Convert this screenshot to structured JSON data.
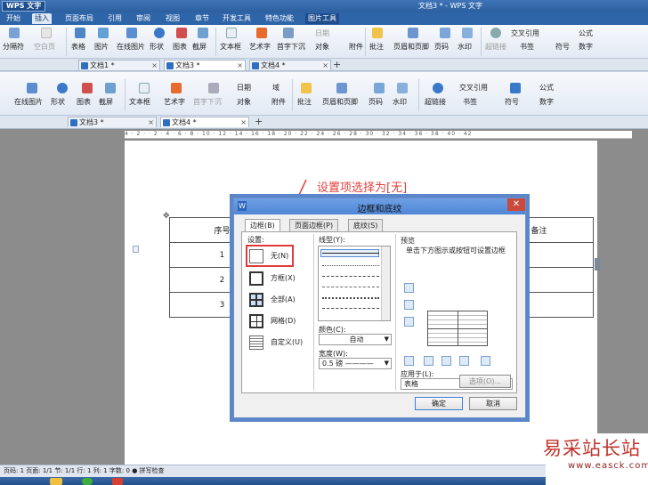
{
  "app": {
    "name": "WPS 文字",
    "window_title": "文档3 * - WPS 文字"
  },
  "menu": [
    "开始",
    "插入",
    "页面布局",
    "引用",
    "审阅",
    "视图",
    "章节",
    "开发工具",
    "特色功能",
    "图片工具"
  ],
  "ribbon1": [
    "分隔符",
    "空白页",
    "表格",
    "图片",
    "在线图片",
    "形状",
    "图表",
    "截屏",
    "文本框",
    "艺术字",
    "首字下沉",
    "日期",
    "对象",
    "附件",
    "批注",
    "页眉和页脚",
    "页码",
    "水印",
    "超链接",
    "交叉引用",
    "书签",
    "符号",
    "公式",
    "数字"
  ],
  "doc_tabs_1": [
    "文档1 *",
    "文档3 *",
    "文档4 *"
  ],
  "ribbon2": [
    "在线图片",
    "形状",
    "图表",
    "截屏",
    "文本框",
    "艺术字",
    "首字下沉",
    "日期",
    "域",
    "对象",
    "附件",
    "批注",
    "页眉和页脚",
    "页码",
    "水印",
    "超链接",
    "交叉引用",
    "书签",
    "符号",
    "公式",
    "数字"
  ],
  "doc_tabs_2": [
    "文档3 *",
    "文档4 *"
  ],
  "ruler": "4 · 2 · · 2 · 4 · 6 · 8 · 10 · 12 · 14 · 16 · 18 · 20 · 22 · 24 · 26 · 28 · 30 · 32 · 34 · 36 · 38 · 40 · 42",
  "annotation": "设置项选择为[无]",
  "table": {
    "header": [
      "序号",
      "",
      "",
      "",
      "",
      "备注"
    ],
    "rows": [
      [
        "1"
      ],
      [
        "2"
      ],
      [
        "3"
      ]
    ]
  },
  "dialog": {
    "title": "边框和底纹",
    "tabs": [
      "边框(B)",
      "页面边框(P)",
      "底纹(S)"
    ],
    "settings_label": "设置:",
    "settings": [
      "无(N)",
      "方框(X)",
      "全部(A)",
      "网格(D)",
      "自定义(U)"
    ],
    "linestyle_label": "线型(Y):",
    "color_label": "颜色(C):",
    "color_value": "自动",
    "width_label": "宽度(W):",
    "width_value": "0.5  磅 ————",
    "preview_label": "预览",
    "preview_hint": "单击下方图示或按钮可设置边框",
    "apply_label": "应用于(L):",
    "apply_value": "表格",
    "options_button": "选项(O)...",
    "ok": "确定",
    "cancel": "取消"
  },
  "status": "页码: 1  页面: 1/1  节: 1/1  行: 1  列: 1  字数: 0  ● 拼写检查",
  "watermark": {
    "main": "易采站长站",
    "url": "www.easck.com"
  },
  "colors": {
    "title_bar": "#2b5f9f",
    "highlight": "#e03a3a",
    "dialog_frame": "#5b86c9"
  }
}
